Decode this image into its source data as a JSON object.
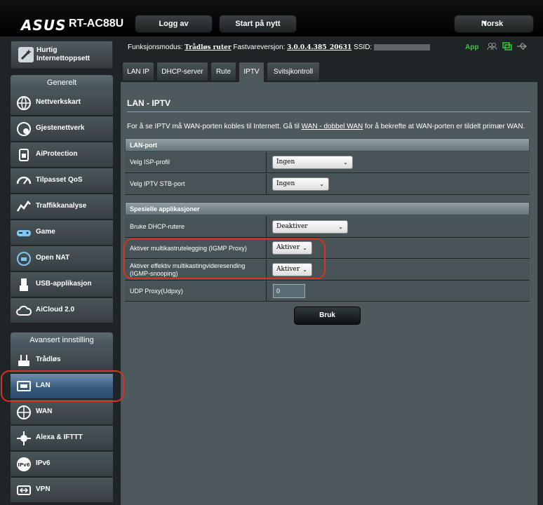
{
  "header": {
    "brand": "ASUS",
    "model": "RT-AC88U",
    "logout": "Logg av",
    "reboot": "Start på nytt",
    "language": "Norsk"
  },
  "status": {
    "mode_label": "Funksjonsmodus:",
    "mode_value": "Trådløs ruter",
    "fw_label": "Fastvareversjon:",
    "fw_value": "3.0.0.4.385_20631",
    "ssid_label": "SSID:",
    "app_label": "App"
  },
  "sidebar": {
    "quick_setup": "Hurtig Internettoppsett",
    "general_title": "Generelt",
    "general_items": [
      {
        "label": "Nettverkskart",
        "icon": "network-map-icon"
      },
      {
        "label": "Gjestenettverk",
        "icon": "guest-network-icon"
      },
      {
        "label": "AiProtection",
        "icon": "aiprotection-icon"
      },
      {
        "label": "Tilpasset QoS",
        "icon": "qos-icon"
      },
      {
        "label": "Traffikkanalyse",
        "icon": "traffic-analyzer-icon"
      },
      {
        "label": "Game",
        "icon": "gamepad-icon"
      },
      {
        "label": "Open NAT",
        "icon": "open-nat-icon"
      },
      {
        "label": "USB-applikasjon",
        "icon": "usb-icon"
      },
      {
        "label": "AiCloud 2.0",
        "icon": "cloud-icon"
      }
    ],
    "advanced_title": "Avansert innstilling",
    "advanced_items": [
      {
        "label": "Trådløs",
        "icon": "wireless-icon"
      },
      {
        "label": "LAN",
        "icon": "lan-icon"
      },
      {
        "label": "WAN",
        "icon": "wan-icon"
      },
      {
        "label": "Alexa & IFTTT",
        "icon": "alexa-icon"
      },
      {
        "label": "IPv6",
        "icon": "ipv6-icon"
      },
      {
        "label": "VPN",
        "icon": "vpn-icon"
      }
    ]
  },
  "tabs": [
    "LAN IP",
    "DHCP-server",
    "Rute",
    "IPTV",
    "Svitsjkontroll"
  ],
  "page": {
    "title": "LAN - IPTV",
    "desc_before": "For å se IPTV må WAN-porten kobles til Internett. Gå til ",
    "desc_link": "WAN - dobbel WAN",
    "desc_after": " for å bekrefte at WAN-porten er tildelt primær WAN.",
    "lan_port_title": "LAN-port",
    "isp_profile_label": "Velg ISP-profil",
    "isp_profile_value": "Ingen",
    "stb_port_label": "Velg IPTV STB-port",
    "stb_port_value": "Ingen",
    "special_title": "Spesielle applikasjoner",
    "dhcp_routes_label": "Bruke DHCP-rutere",
    "dhcp_routes_value": "Deaktiver",
    "igmp_proxy_label": "Aktiver multikastrutelegging (IGMP Proxy)",
    "igmp_proxy_value": "Aktiver",
    "igmp_snoop_label": "Aktiver effektiv multikastingvideresending (IGMP-snooping)",
    "igmp_snoop_value": "Aktiver",
    "udpxy_label": "UDP Proxy(Udpxy)",
    "udpxy_value": "0",
    "apply": "Bruk"
  },
  "colors": {
    "accent_highlight": "#d63320",
    "active_nav": "#33587a",
    "app_status": "#33cc33"
  }
}
